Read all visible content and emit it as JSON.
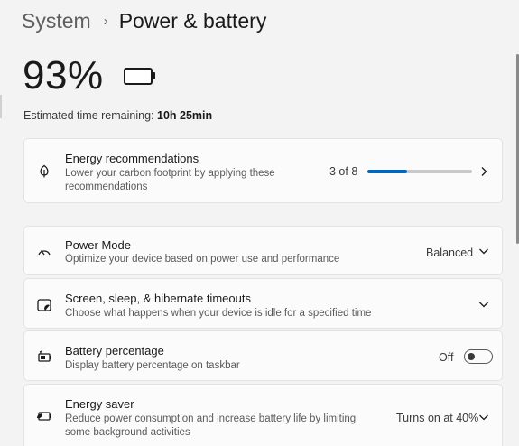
{
  "breadcrumb": {
    "parent": "System",
    "separator": "›",
    "current": "Power & battery"
  },
  "battery": {
    "percent_label": "93%",
    "level": 0.93,
    "estimate_label": "Estimated time remaining:",
    "estimate_value": "10h 25min"
  },
  "cards": {
    "energy_recommendations": {
      "title": "Energy recommendations",
      "subtitle": "Lower your carbon footprint by applying these recommendations",
      "progress_label": "3 of 8",
      "progress_fraction": 0.375,
      "icon": "leaf-icon"
    },
    "power_mode": {
      "title": "Power Mode",
      "subtitle": "Optimize your device based on power use and performance",
      "value": "Balanced",
      "icon": "speedometer-icon"
    },
    "screen_sleep": {
      "title": "Screen, sleep, & hibernate timeouts",
      "subtitle": "Choose what happens when your device is idle for a specified time",
      "icon": "screen-sleep-icon"
    },
    "battery_percentage": {
      "title": "Battery percentage",
      "subtitle": "Display battery percentage on taskbar",
      "toggle_label": "Off",
      "icon": "battery-percent-icon"
    },
    "energy_saver": {
      "title": "Energy saver",
      "subtitle_line1": "Reduce power consumption and increase battery life by limiting",
      "subtitle_line2": "some background activities",
      "value": "Turns on at 40%",
      "icon": "energy-saver-icon"
    }
  },
  "colors": {
    "accent": "#0067c0",
    "background": "#f3f3f3",
    "card": "#fbfbfb"
  }
}
